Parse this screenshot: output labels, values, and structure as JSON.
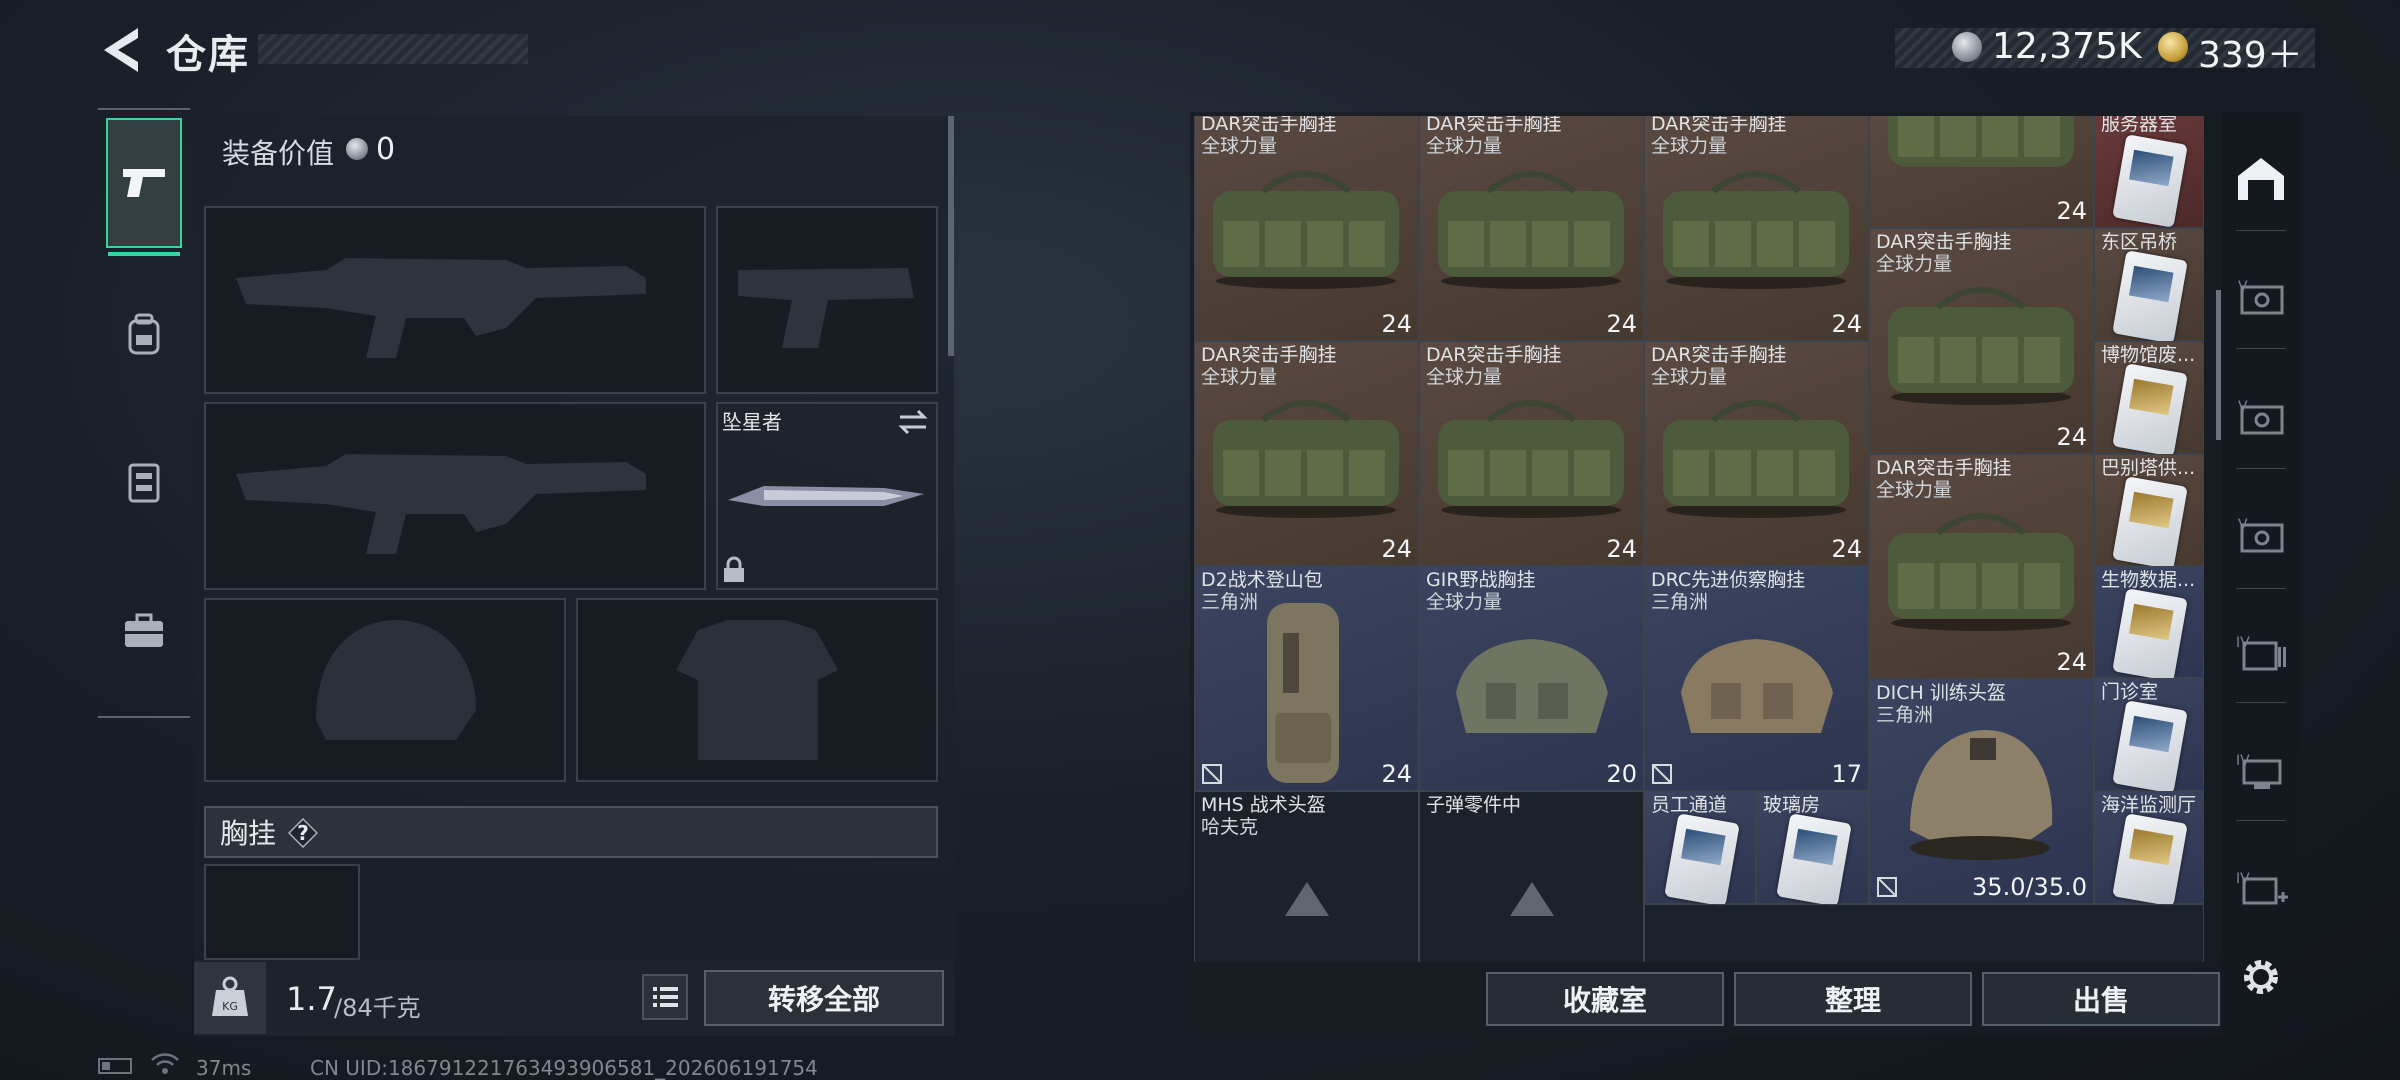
{
  "header": {
    "title": "仓库"
  },
  "currency": {
    "silver": "12,375K",
    "gold": "339＋"
  },
  "categories": [
    {
      "name": "weapon",
      "icon": "pistol-icon",
      "selected": true
    },
    {
      "name": "backpack",
      "icon": "backpack-icon",
      "selected": false
    },
    {
      "name": "chest-rig",
      "icon": "vest-icon",
      "selected": false
    },
    {
      "name": "case",
      "icon": "briefcase-icon",
      "selected": false
    }
  ],
  "loadout": {
    "equip_value_label": "装备价值",
    "equip_value": "0",
    "melee_name": "坠星者",
    "chest_label": "胸挂",
    "chest_help": "?",
    "weight_value": "1.7",
    "weight_max": "/84千克",
    "transfer_all": "转移全部"
  },
  "status": {
    "ping": "37ms",
    "uid": "CN UID:1867912217634939065​81_202606191754"
  },
  "storage": {
    "items": [
      {
        "name": "DAR突击手胸挂",
        "sub": "全球力量",
        "qty": "24"
      },
      {
        "name": "DAR突击手胸挂",
        "sub": "全球力量",
        "qty": "24"
      },
      {
        "name": "DAR突击手胸挂",
        "sub": "全球力量",
        "qty": "24"
      },
      {
        "name": "",
        "sub": "",
        "qty": "24"
      },
      {
        "name": "服务器室",
        "sub": "",
        "qty": ""
      },
      {
        "name": "DAR突击手胸挂",
        "sub": "全球力量",
        "qty": "24"
      },
      {
        "name": "东区吊桥",
        "sub": "",
        "qty": ""
      },
      {
        "name": "DAR突击手胸挂",
        "sub": "全球力量",
        "qty": "24"
      },
      {
        "name": "DAR突击手胸挂",
        "sub": "全球力量",
        "qty": "24"
      },
      {
        "name": "DAR突击手胸挂",
        "sub": "全球力量",
        "qty": "24"
      },
      {
        "name": "博物馆废...",
        "sub": "",
        "qty": ""
      },
      {
        "name": "DAR突击手胸挂",
        "sub": "全球力量",
        "qty": "24"
      },
      {
        "name": "巴别塔供...",
        "sub": "",
        "qty": ""
      },
      {
        "name": "D2战术登山包",
        "sub": "三角洲",
        "qty": "24"
      },
      {
        "name": "GIR野战胸挂",
        "sub": "全球力量",
        "qty": "20"
      },
      {
        "name": "DRC先进侦察胸挂",
        "sub": "三角洲",
        "qty": "17"
      },
      {
        "name": "生物数据...",
        "sub": "",
        "qty": ""
      },
      {
        "name": "DICH 训练头盔",
        "sub": "三角洲",
        "qty": "35.0/35.0"
      },
      {
        "name": "门诊室",
        "sub": "",
        "qty": ""
      },
      {
        "name": "MHS 战术头盔",
        "sub": "哈夫克",
        "qty": ""
      },
      {
        "name": "子弹零件中",
        "sub": "",
        "qty": ""
      },
      {
        "name": "员工通道",
        "sub": "",
        "qty": ""
      },
      {
        "name": "玻璃房",
        "sub": "",
        "qty": ""
      },
      {
        "name": "海洋监测厅",
        "sub": "",
        "qty": ""
      }
    ]
  },
  "actions": {
    "collect": "收藏室",
    "sort": "整理",
    "sell": "出售"
  },
  "colors": {
    "accent": "#39d3a0",
    "rare_blue": "#3b4460",
    "rare_brown": "#5a4a42",
    "rare_red": "#6a3a3a"
  }
}
